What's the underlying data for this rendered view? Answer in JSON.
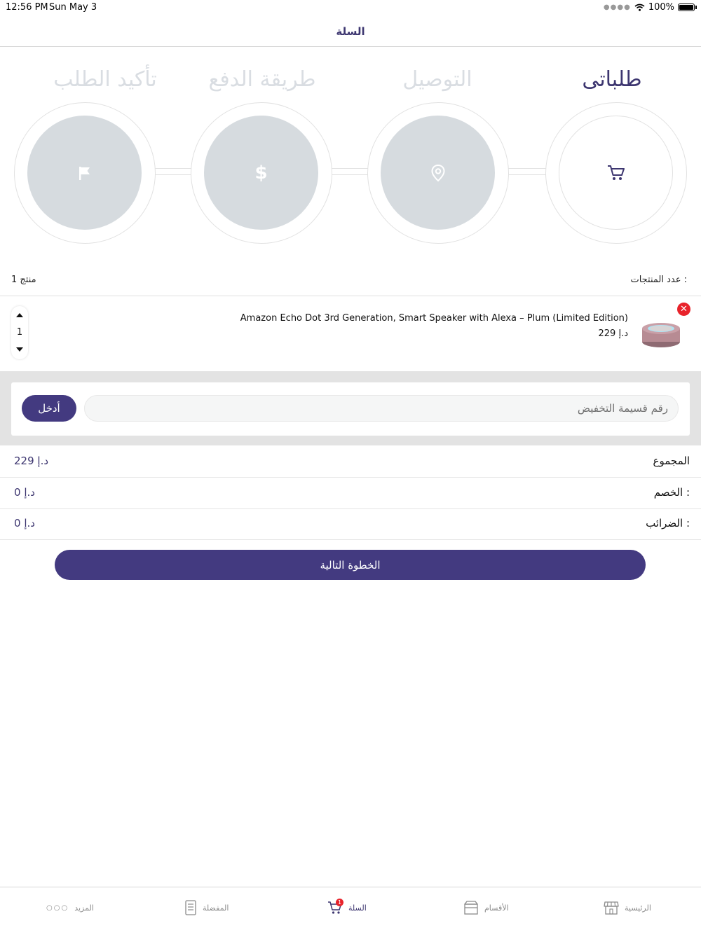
{
  "status_bar": {
    "time": "12:56 PM",
    "date": "Sun May 3",
    "battery": "100%"
  },
  "header": {
    "title": "السلة"
  },
  "steps": [
    {
      "label": "طلباتى",
      "icon": "cart-icon",
      "active": true
    },
    {
      "label": "التوصيل",
      "icon": "location-pin-icon",
      "active": false
    },
    {
      "label": "طريقة الدفع",
      "icon": "dollar-icon",
      "active": false
    },
    {
      "label": "تأكيد الطلب",
      "icon": "flag-icon",
      "active": false
    }
  ],
  "products_count": {
    "label": "عدد المنتجات :",
    "value": "1 منتج"
  },
  "cart_item": {
    "name": "Amazon Echo Dot 3rd Generation, Smart Speaker with Alexa – Plum (Limited Edition)",
    "price": "229 د.إ",
    "quantity": "1"
  },
  "coupon": {
    "placeholder": "رقم قسيمة التخفيض",
    "button_label": "أدخل"
  },
  "totals": {
    "subtotal_label": "المجموع",
    "subtotal_value": "229 د.إ",
    "discount_label": "الخصم :",
    "discount_value": "0 د.إ",
    "taxes_label": "الضرائب :",
    "taxes_value": "0 د.إ"
  },
  "next_button": "الخطوة التالية",
  "tabbar": {
    "home": "الرئيسية",
    "categories": "الأقسام",
    "cart": "السلة",
    "cart_badge": "1",
    "favorites": "المفضلة",
    "more": "المزيد"
  },
  "colors": {
    "accent": "#433a80",
    "inactive_step": "#d6dbdf",
    "remove": "#e8232b"
  }
}
